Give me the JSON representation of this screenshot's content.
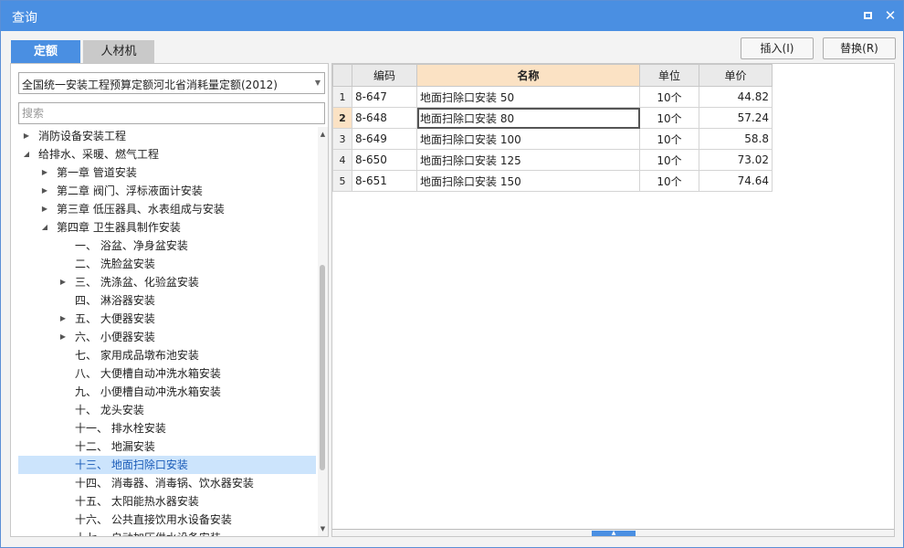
{
  "window": {
    "title": "查询",
    "maximize_icon": "maximize-icon",
    "close_icon": "close-icon",
    "close_glyph": "✕"
  },
  "tabs": [
    {
      "label": "定额",
      "active": true
    },
    {
      "label": "人材机",
      "active": false
    }
  ],
  "toolbar": {
    "insert_label": "插入(I)",
    "replace_label": "替换(R)"
  },
  "left": {
    "library_select": "全国统一安装工程预算定额河北省消耗量定额(2012)",
    "search_placeholder": "搜索",
    "tree": [
      {
        "label": "消防设备安装工程",
        "level": 0,
        "arrow": "▶"
      },
      {
        "label": "给排水、采暖、燃气工程",
        "level": 0,
        "arrow": "◢"
      },
      {
        "label": "第一章 管道安装",
        "level": 1,
        "arrow": "▶"
      },
      {
        "label": "第二章 阀门、浮标液面计安装",
        "level": 1,
        "arrow": "▶"
      },
      {
        "label": "第三章 低压器具、水表组成与安装",
        "level": 1,
        "arrow": "▶"
      },
      {
        "label": "第四章 卫生器具制作安装",
        "level": 1,
        "arrow": "◢"
      },
      {
        "label": "一、 浴盆、净身盆安装",
        "level": 2,
        "arrow": ""
      },
      {
        "label": "二、 洗脸盆安装",
        "level": 2,
        "arrow": ""
      },
      {
        "label": "三、 洗涤盆、化验盆安装",
        "level": 2,
        "arrow": "▶"
      },
      {
        "label": "四、 淋浴器安装",
        "level": 2,
        "arrow": ""
      },
      {
        "label": "五、 大便器安装",
        "level": 2,
        "arrow": "▶"
      },
      {
        "label": "六、 小便器安装",
        "level": 2,
        "arrow": "▶"
      },
      {
        "label": "七、 家用成品墩布池安装",
        "level": 2,
        "arrow": ""
      },
      {
        "label": "八、 大便槽自动冲洗水箱安装",
        "level": 2,
        "arrow": ""
      },
      {
        "label": "九、 小便槽自动冲洗水箱安装",
        "level": 2,
        "arrow": ""
      },
      {
        "label": "十、 龙头安装",
        "level": 2,
        "arrow": ""
      },
      {
        "label": "十一、 排水栓安装",
        "level": 2,
        "arrow": ""
      },
      {
        "label": "十二、 地漏安装",
        "level": 2,
        "arrow": ""
      },
      {
        "label": "十三、 地面扫除口安装",
        "level": 2,
        "arrow": "",
        "selected": true
      },
      {
        "label": "十四、 消毒器、消毒锅、饮水器安装",
        "level": 2,
        "arrow": ""
      },
      {
        "label": "十五、 太阳能热水器安装",
        "level": 2,
        "arrow": ""
      },
      {
        "label": "十六、 公共直接饮用水设备安装",
        "level": 2,
        "arrow": ""
      },
      {
        "label": "十七、 自动加压供水设备安装",
        "level": 2,
        "arrow": ""
      }
    ]
  },
  "grid": {
    "columns": [
      "",
      "编码",
      "名称",
      "单位",
      "单价"
    ],
    "active_column": "名称",
    "rows": [
      {
        "num": "1",
        "code": "8-647",
        "name": "地面扫除口安装 50",
        "unit": "10个",
        "price": "44.82"
      },
      {
        "num": "2",
        "code": "8-648",
        "name": "地面扫除口安装 80",
        "unit": "10个",
        "price": "57.24",
        "current": true
      },
      {
        "num": "3",
        "code": "8-649",
        "name": "地面扫除口安装 100",
        "unit": "10个",
        "price": "58.8"
      },
      {
        "num": "4",
        "code": "8-650",
        "name": "地面扫除口安装 125",
        "unit": "10个",
        "price": "73.02"
      },
      {
        "num": "5",
        "code": "8-651",
        "name": "地面扫除口安装 150",
        "unit": "10个",
        "price": "74.64"
      }
    ]
  },
  "colors": {
    "accent": "#4a8fe2",
    "selected_row_bg": "#cce4fc",
    "active_header_bg": "#fbe2c4"
  }
}
